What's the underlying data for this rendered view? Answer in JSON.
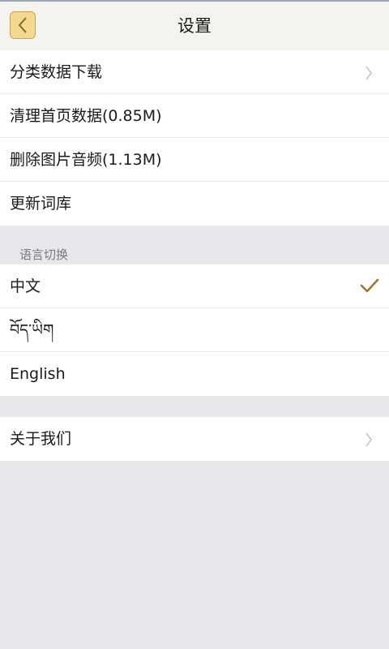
{
  "header": {
    "title": "设置"
  },
  "settings": {
    "items": [
      {
        "label": "分类数据下载"
      },
      {
        "label": "清理首页数据(0.85M)"
      },
      {
        "label": "删除图片音频(1.13M)"
      },
      {
        "label": "更新词库"
      }
    ]
  },
  "language": {
    "section_label": "语言切换",
    "options": [
      {
        "label": "中文",
        "selected": true
      },
      {
        "label": "བོད་ཡིག",
        "selected": false
      },
      {
        "label": "English",
        "selected": false
      }
    ]
  },
  "about": {
    "label": "关于我们"
  },
  "colors": {
    "accent": "#a07828",
    "header_bg": "#f5f3ef",
    "page_bg": "#e8e8ec",
    "back_button_bg": "#f3d98f"
  }
}
